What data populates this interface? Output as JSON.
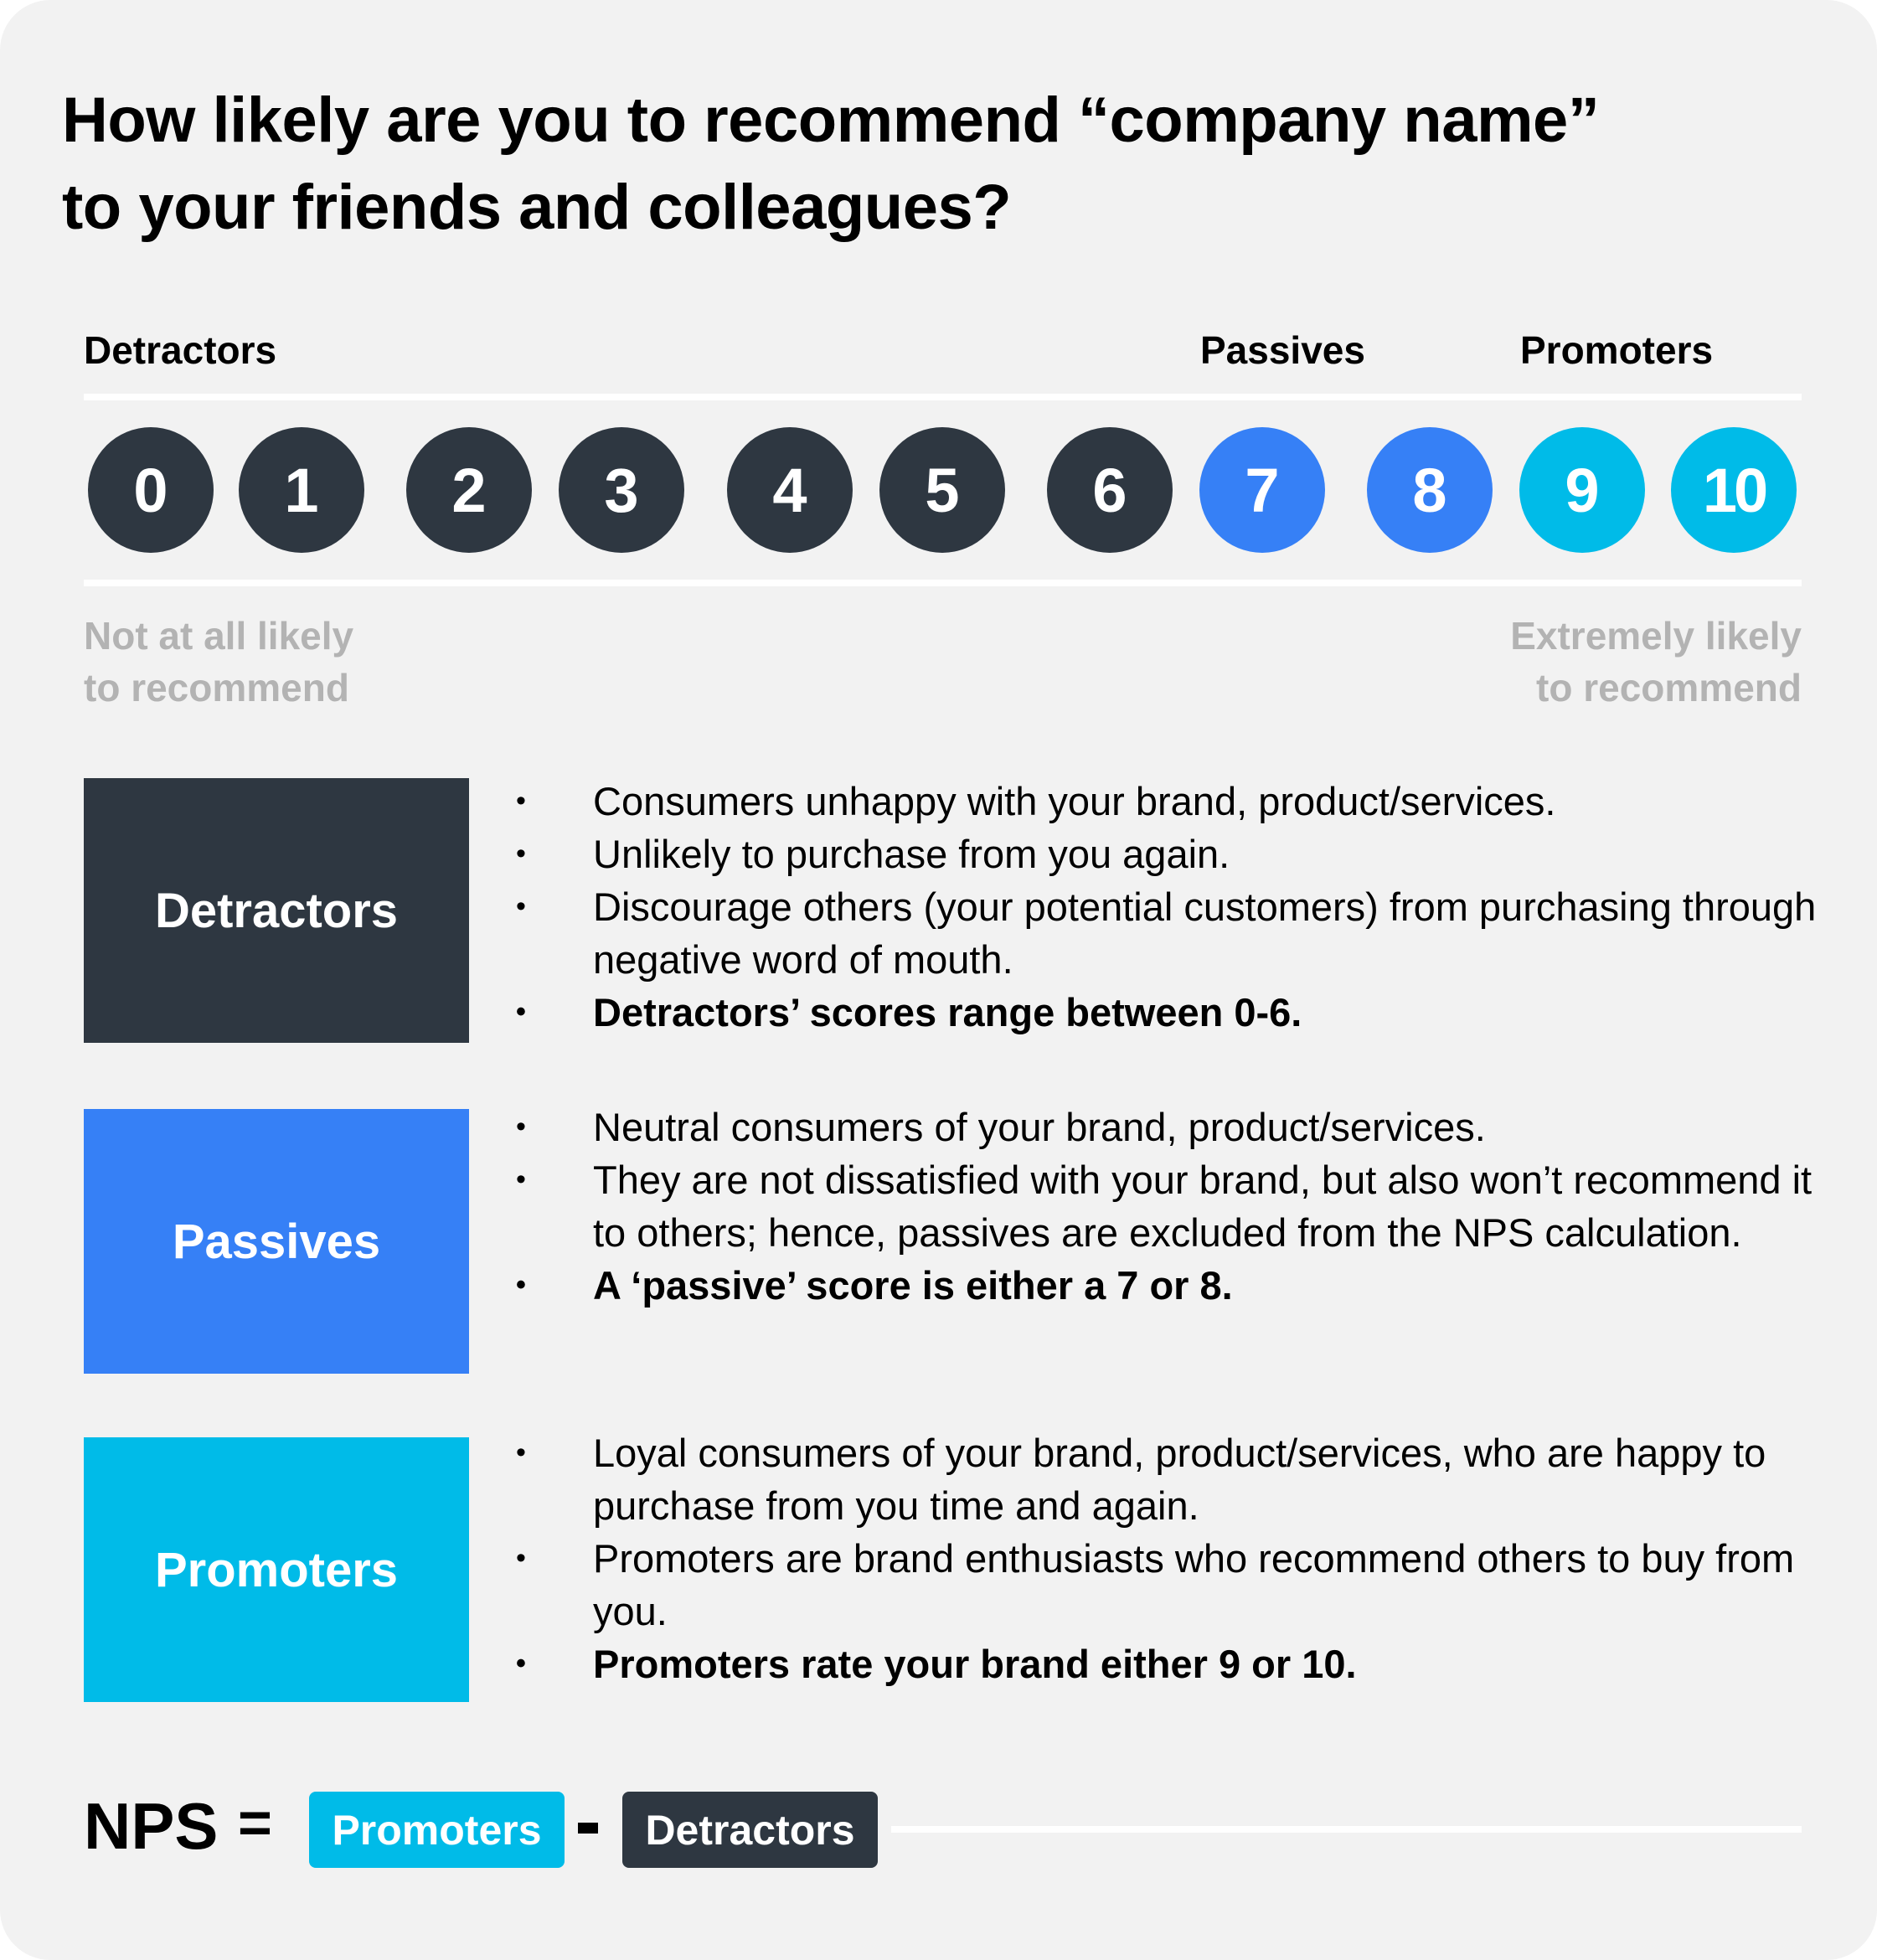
{
  "title": {
    "line1": "How likely are you to recommend “company name”",
    "line2": "to your friends and colleagues?"
  },
  "groups": {
    "detractors": "Detractors",
    "passives": "Passives",
    "promoters": "Promoters"
  },
  "colors": {
    "detractor": "#2e3741",
    "passive": "#3680f6",
    "promoter": "#00bbe8",
    "background": "#f2f2f2",
    "muted_text": "#b3b3b3"
  },
  "scale": {
    "scores": [
      {
        "label": "0",
        "group": "detractor"
      },
      {
        "label": "1",
        "group": "detractor"
      },
      {
        "label": "2",
        "group": "detractor"
      },
      {
        "label": "3",
        "group": "detractor"
      },
      {
        "label": "4",
        "group": "detractor"
      },
      {
        "label": "5",
        "group": "detractor"
      },
      {
        "label": "6",
        "group": "detractor"
      },
      {
        "label": "7",
        "group": "passive"
      },
      {
        "label": "8",
        "group": "passive"
      },
      {
        "label": "9",
        "group": "promoter"
      },
      {
        "label": "10",
        "group": "promoter"
      }
    ],
    "low_end": {
      "line1": "Not at all likely",
      "line2": "to recommend"
    },
    "high_end": {
      "line1": "Extremely likely",
      "line2": "to recommend"
    }
  },
  "categories": [
    {
      "name": "Detractors",
      "group": "detractor",
      "bullets": [
        {
          "text": "Consumers unhappy with your brand, product/services.",
          "bold": false
        },
        {
          "text": "Unlikely to purchase from you again.",
          "bold": false
        },
        {
          "text": "Discourage others (your potential customers) from purchasing through negative word of mouth.",
          "bold": false
        },
        {
          "text": "Detractors’ scores range between 0-6.",
          "bold": true
        }
      ]
    },
    {
      "name": "Passives",
      "group": "passive",
      "bullets": [
        {
          "text": "Neutral consumers of your brand, product/services.",
          "bold": false
        },
        {
          "text": "They are not dissatisfied with your brand, but also won’t recommend it to others; hence, passives are excluded from the NPS calculation.",
          "bold": false
        },
        {
          "text": "A ‘passive’ score is either a 7 or 8.",
          "bold": true
        }
      ]
    },
    {
      "name": "Promoters",
      "group": "promoter",
      "bullets": [
        {
          "text": "Loyal consumers of your brand, product/services, who are happy to purchase from you time and again.",
          "bold": false
        },
        {
          "text": "Promoters are brand enthusiasts who recommend others to buy from you.",
          "bold": false
        },
        {
          "text": "Promoters rate your brand either 9 or 10.",
          "bold": true
        }
      ]
    }
  ],
  "formula": {
    "label": "NPS",
    "equals": "=",
    "minus": "-",
    "term1": "Promoters",
    "term2": "Detractors"
  }
}
